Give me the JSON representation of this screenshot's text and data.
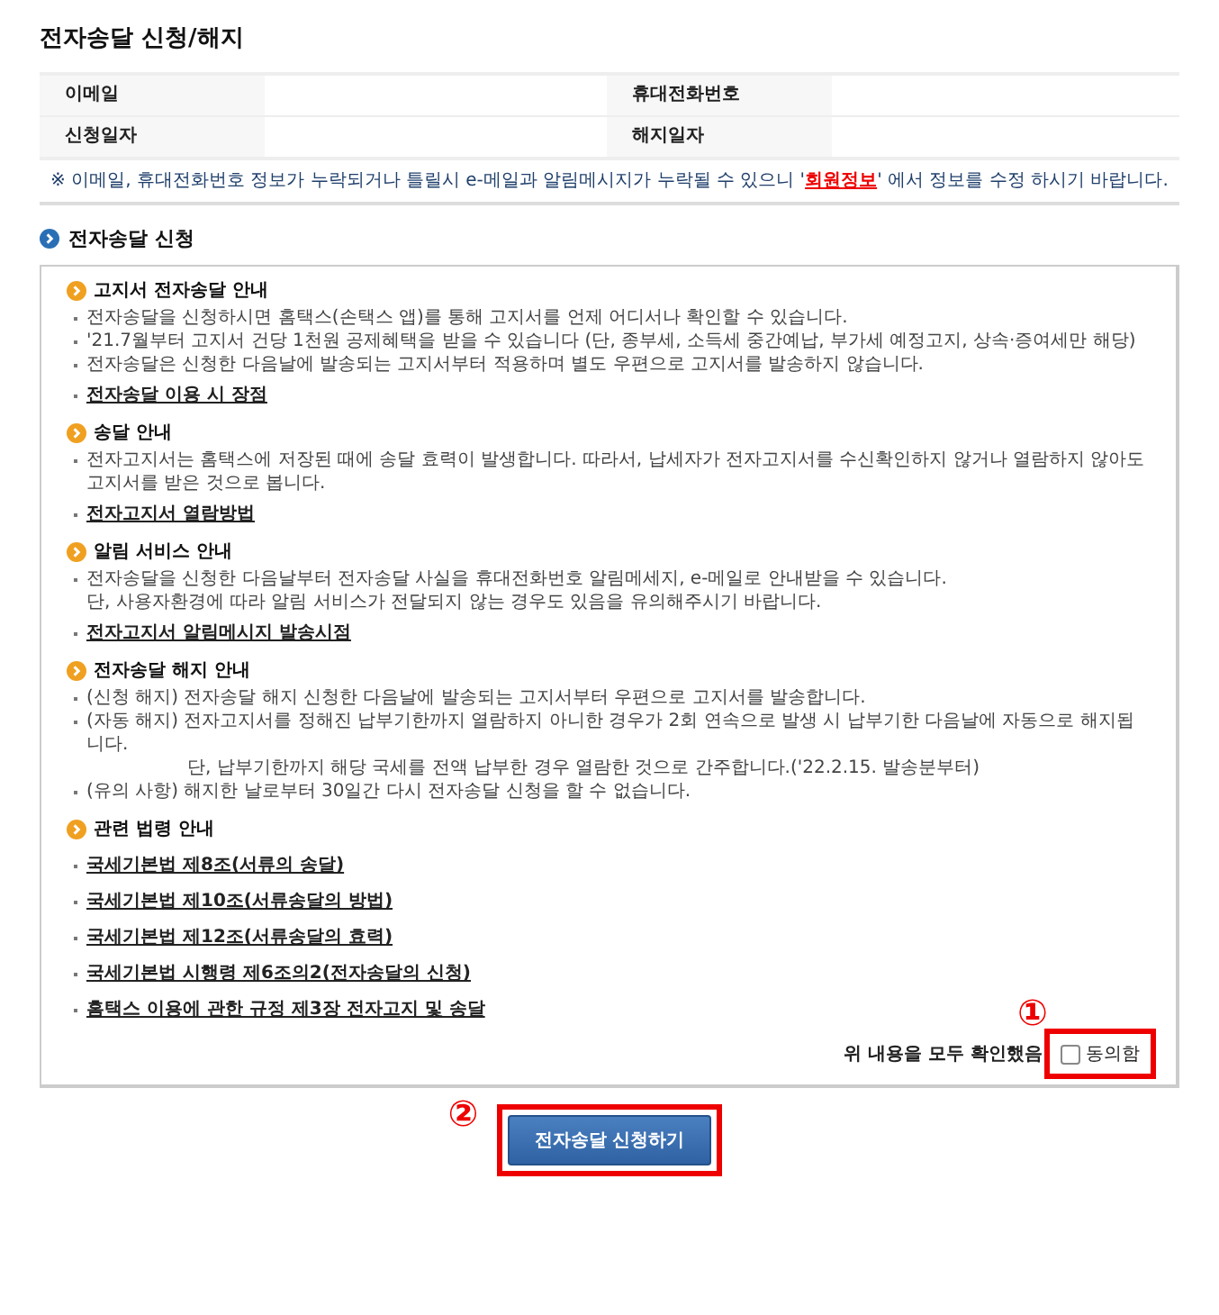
{
  "title": "전자송달 신청/해지",
  "info_fields": [
    {
      "label": "이메일"
    },
    {
      "label": "휴대전화번호"
    },
    {
      "label": "신청일자"
    },
    {
      "label": "해지일자"
    }
  ],
  "note": {
    "mark": "※",
    "before": "이메일, 휴대전화번호 정보가 누락되거나 틀릴시 e-메일과 알림메시지가 누락될 수 있으니 '",
    "link": "회원정보",
    "after": "' 에서 정보를 수정 하시기 바랍니다."
  },
  "section_title": "전자송달 신청",
  "sections": [
    {
      "heading": "고지서 전자송달 안내",
      "bullets": [
        {
          "lines": [
            "전자송달을 신청하시면 홈택스(손택스 앱)를 통해 고지서를 언제 어디서나 확인할 수 있습니다."
          ]
        },
        {
          "lines": [
            "'21.7월부터 고지서 건당 1천원 공제혜택을 받을 수 있습니다 (단, 종부세, 소득세 중간예납, 부가세 예정고지, 상속·증여세만 해당)"
          ]
        },
        {
          "lines": [
            "전자송달은 신청한 다음날에 발송되는 고지서부터 적용하며 별도 우편으로 고지서를 발송하지 않습니다."
          ]
        }
      ],
      "links": [
        "전자송달 이용 시 장점"
      ]
    },
    {
      "heading": "송달 안내",
      "bullets": [
        {
          "lines": [
            "전자고지서는 홈택스에 저장된 때에 송달 효력이 발생합니다. 따라서, 납세자가 전자고지서를 수신확인하지 않거나 열람하지 않아도 고지서를 받은 것으로 봅니다."
          ]
        }
      ],
      "links": [
        "전자고지서 열람방법"
      ]
    },
    {
      "heading": "알림 서비스 안내",
      "bullets": [
        {
          "lines": [
            "전자송달을 신청한 다음날부터 전자송달 사실을 휴대전화번호 알림메세지, e-메일로 안내받을 수 있습니다.",
            "단, 사용자환경에 따라 알림 서비스가 전달되지 않는 경우도 있음을 유의해주시기 바랍니다."
          ]
        }
      ],
      "links": [
        "전자고지서 알림메시지 발송시점"
      ]
    },
    {
      "heading": "전자송달 해지 안내",
      "bullets": [
        {
          "lines": [
            "(신청 해지) 전자송달 해지 신청한 다음날에 발송되는 고지서부터 우편으로 고지서를 발송합니다."
          ]
        },
        {
          "lines": [
            "(자동 해지) 전자고지서를 정해진 납부기한까지 열람하지 아니한 경우가 2회 연속으로 발생 시 납부기한 다음날에 자동으로 해지됩니다.",
            "단, 납부기한까지 해당 국세를 전액 납부한 경우 열람한 것으로 간주합니다.('22.2.15. 발송분부터)"
          ]
        },
        {
          "lines": [
            "(유의 사항) 해지한 날로부터 30일간 다시 전자송달 신청을 할 수 없습니다."
          ]
        }
      ]
    },
    {
      "heading": "관련 법령 안내",
      "links": [
        "국세기본법 제8조(서류의 송달)",
        "국세기본법 제10조(서류송달의 방법)",
        "국세기본법 제12조(서류송달의 효력)",
        "국세기본법 시행령 제6조의2(전자송달의 신청)",
        "홈택스 이용에 관한 규정 제3장 전자고지 및 송달"
      ]
    }
  ],
  "confirm_text": "위 내용을 모두 확인했음",
  "agree": {
    "label": "동의함",
    "checked": false,
    "annotation": "①"
  },
  "submit": {
    "label": "전자송달 신청하기",
    "annotation": "②"
  }
}
